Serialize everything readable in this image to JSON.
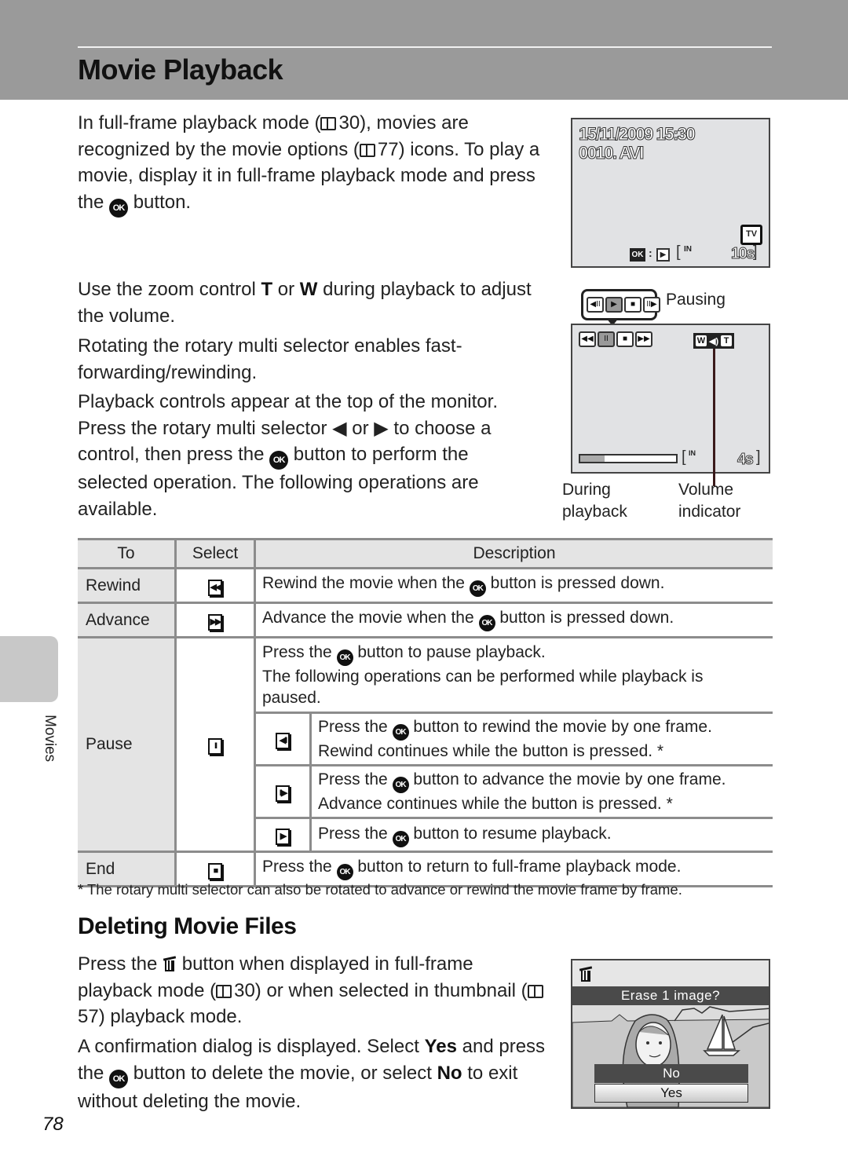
{
  "header": {
    "title": "Movie Playback"
  },
  "side_tab": {
    "label": "Movies"
  },
  "intro": {
    "p1": [
      "In full-frame playback mode (",
      "30), movies are recognized by the movie options (",
      "77) icons. To play a movie, display it in full-frame playback mode and press the ",
      " button."
    ],
    "p2": [
      "Use the zoom control ",
      "T",
      " or ",
      "W",
      " during playback to adjust the volume."
    ],
    "p3": "Rotating the rotary multi selector enables fast-forwarding/rewinding.",
    "p4": [
      "Playback controls appear at the top of the monitor. Press the rotary multi selector ",
      "◀",
      " or ",
      "▶",
      " to choose a control, then press the ",
      " button to perform the selected operation. The following operations are available."
    ]
  },
  "ok_symbol": "OK",
  "screen1": {
    "datetime": "15/11/2009 15:30",
    "filename": "0010. AVI",
    "tv_icon": "TV",
    "ok_label": "OK",
    "play_symbol": "▶",
    "memory": "IN",
    "duration": "10s"
  },
  "screen2": {
    "pausing_label": "Pausing",
    "pause_controls": [
      "◀II",
      "▶",
      "■",
      "II▶"
    ],
    "play_controls": [
      "◀◀",
      "II",
      "■",
      "▶▶"
    ],
    "volume": {
      "w": "W",
      "speaker": "◀)",
      "t": "T"
    },
    "memory": "IN",
    "remaining": "4s",
    "progress": 0.25,
    "caption_left": [
      "During",
      "playback"
    ],
    "caption_right": [
      "Volume",
      "indicator"
    ]
  },
  "table": {
    "headers": {
      "to": "To",
      "select": "Select",
      "description": "Description"
    },
    "rows": {
      "rewind": {
        "to": "Rewind",
        "icon": "◀◀",
        "desc": [
          "Rewind the movie when the ",
          " button is pressed down."
        ]
      },
      "advance": {
        "to": "Advance",
        "icon": "▶▶",
        "desc": [
          "Advance the movie when the ",
          " button is pressed down."
        ]
      },
      "pause": {
        "to": "Pause",
        "icon": "II",
        "desc": [
          "Press the ",
          " button to pause playback.",
          "The following operations can be performed while playback is paused."
        ],
        "sub": [
          {
            "icon": "◀II",
            "desc": [
              "Press the ",
              " button to rewind the movie by one frame.",
              "Rewind continues while the button is pressed. *"
            ]
          },
          {
            "icon": "II▶",
            "desc": [
              "Press the ",
              " button to advance the movie by one frame.",
              "Advance continues while the button is pressed. *"
            ]
          },
          {
            "icon": "▶",
            "desc": [
              "Press the ",
              " button to resume playback.",
              ""
            ]
          }
        ]
      },
      "end": {
        "to": "End",
        "icon": "■",
        "desc": [
          "Press the ",
          " button to return to full-frame playback mode."
        ]
      }
    },
    "footnote": "*  The rotary multi selector can also be rotated to advance or rewind the movie frame by frame."
  },
  "deleting": {
    "title": "Deleting Movie Files",
    "p1": [
      "Press the ",
      " button when displayed in full-frame playback mode (",
      "30) or when selected in thumbnail (",
      "57) playback mode."
    ],
    "p2": [
      "A confirmation dialog is displayed. Select ",
      "Yes",
      " and press the ",
      " button to delete the movie, or select ",
      "No",
      " to exit without deleting the movie."
    ],
    "dialog": {
      "title": "Erase 1 image?",
      "no": "No",
      "yes": "Yes"
    }
  },
  "page_number": "78"
}
